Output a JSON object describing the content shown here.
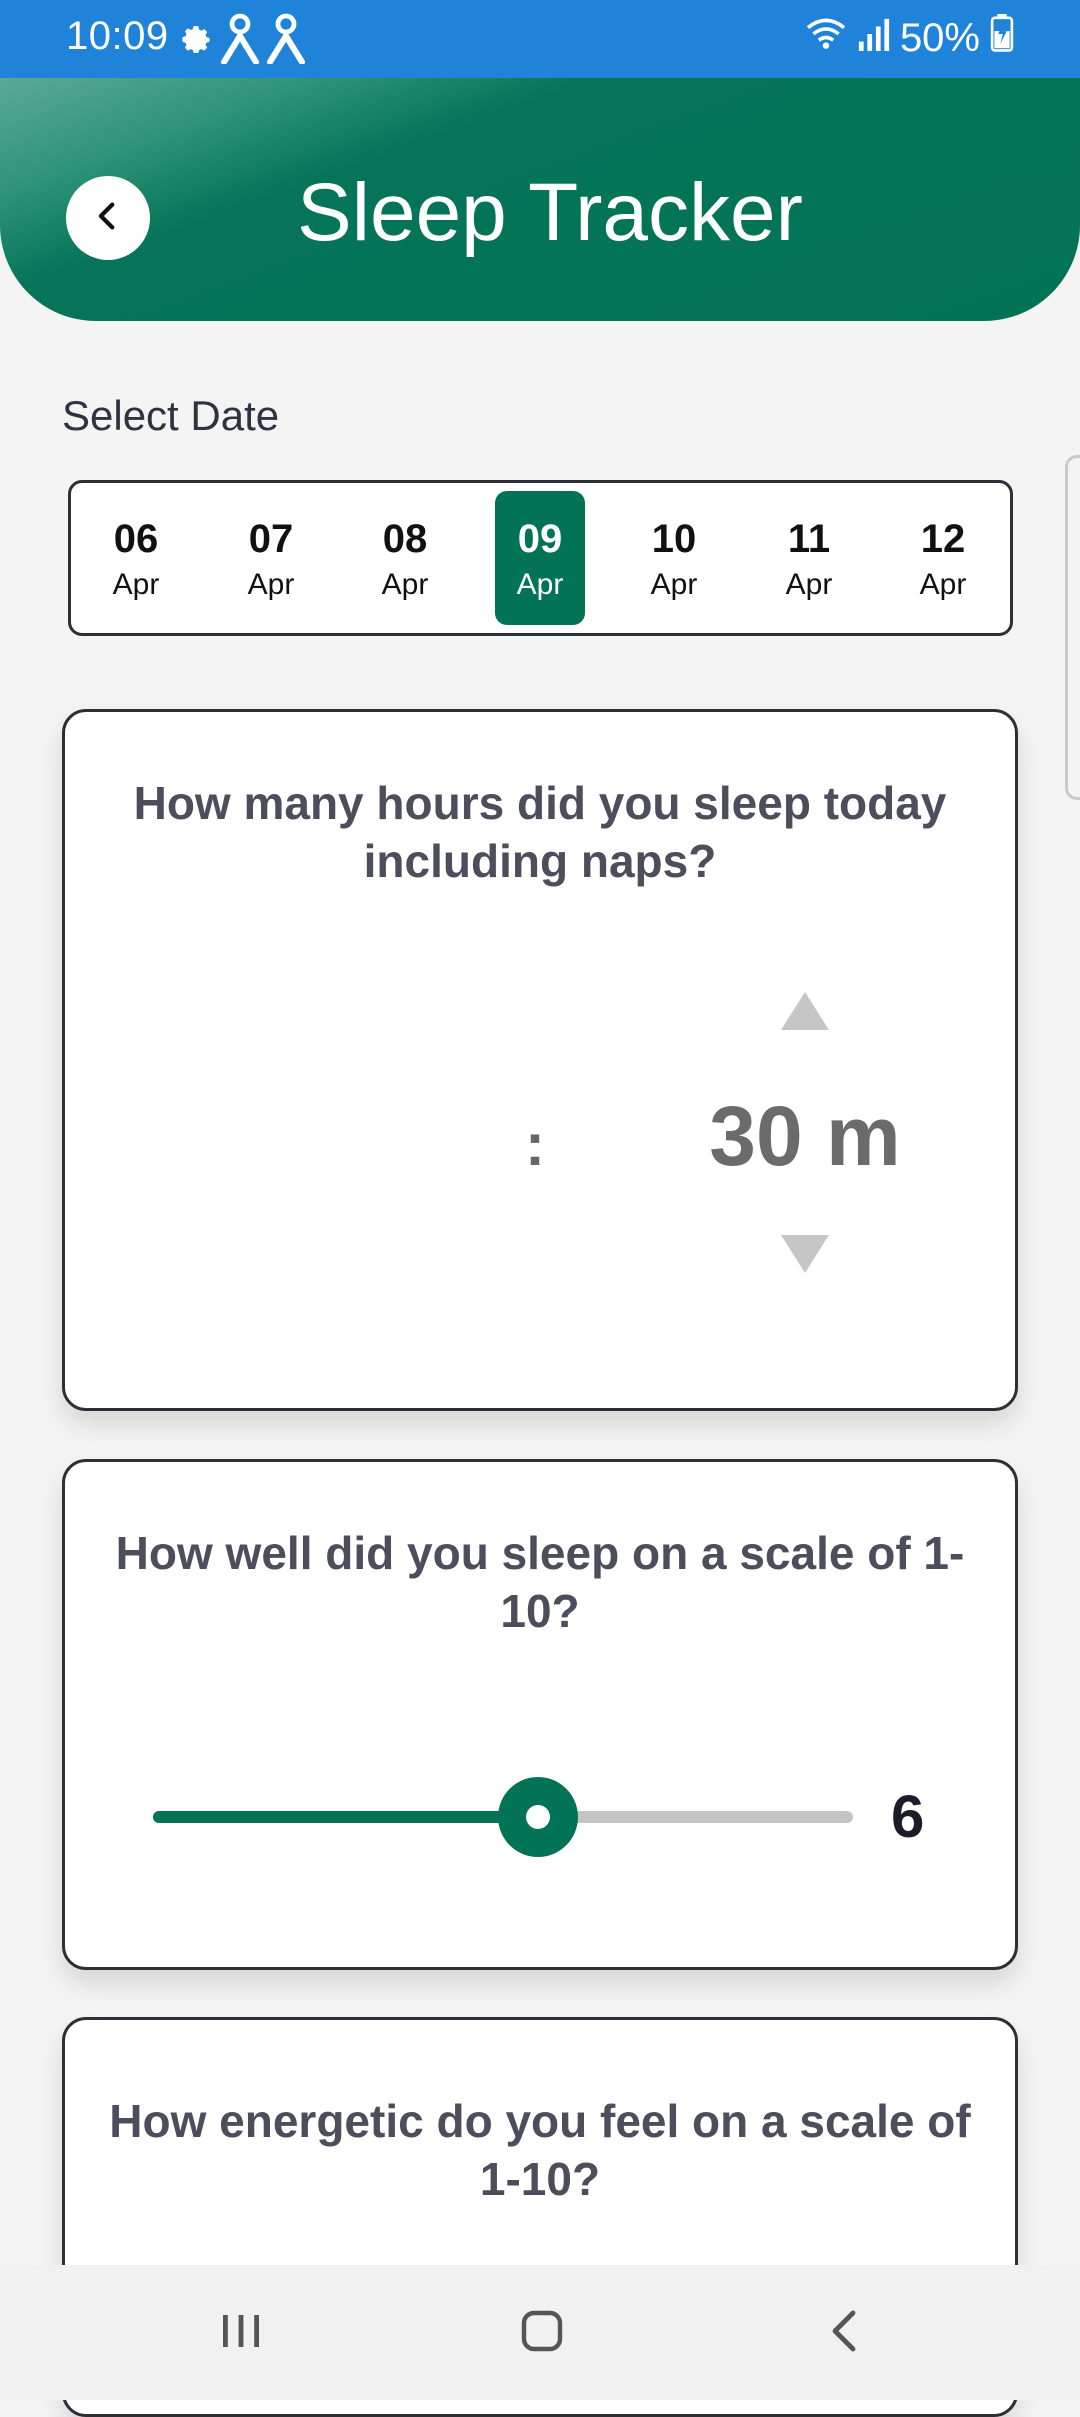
{
  "status_bar": {
    "time": "10:09",
    "battery": "50%",
    "left_icons": [
      "gear-icon",
      "person-icon",
      "person-icon"
    ],
    "right_icons": [
      "wifi-icon",
      "signal-icon",
      "battery-charging-icon"
    ]
  },
  "header": {
    "title": "Sleep Tracker",
    "back_icon": "chevron-left-icon"
  },
  "date_selector": {
    "label": "Select Date",
    "selected_index": 3,
    "dates": [
      {
        "day": "06",
        "month": "Apr"
      },
      {
        "day": "07",
        "month": "Apr"
      },
      {
        "day": "08",
        "month": "Apr"
      },
      {
        "day": "09",
        "month": "Apr"
      },
      {
        "day": "10",
        "month": "Apr"
      },
      {
        "day": "11",
        "month": "Apr"
      },
      {
        "day": "12",
        "month": "Apr"
      }
    ]
  },
  "hours_card": {
    "question": "How many hours did you sleep today including naps?",
    "separator": ":",
    "minutes": "30 m"
  },
  "quality_card": {
    "question": "How well did you sleep on a scale of 1-10?",
    "value": "6",
    "slider_fraction": 0.55
  },
  "energy_card": {
    "question": "How energetic do you feel on a scale of 1-10?"
  },
  "colors": {
    "status_bar": "#1f83d9",
    "accent": "#037355",
    "card_border": "#2e2e36",
    "question_text": "#4d4d5c"
  },
  "nav_bar": {
    "items": [
      "recent-apps-icon",
      "home-icon",
      "back-icon"
    ]
  }
}
